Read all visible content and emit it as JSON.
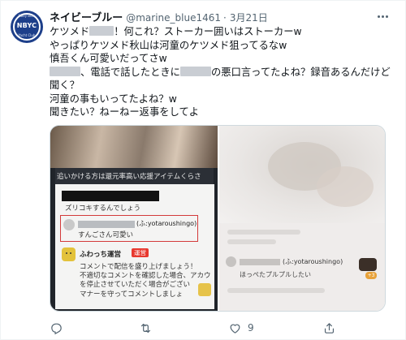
{
  "tweet": {
    "display_name": "ネイビーブルー",
    "handle": "@marine_blue1461",
    "separator": "·",
    "date": "3月21日",
    "avatar_text": "NBYC",
    "avatar_ring_top": "Navy Blue",
    "avatar_ring_bottom": "Yacht Club",
    "lines": [
      {
        "pre": "ケツメド",
        "post": "！何これ？ストーカー囲いはストーカーw"
      },
      {
        "text": "やっぱりケツメド秋山は河童のケツメド狙ってるなw"
      },
      {
        "text": "慎吾くん可愛いだってさw"
      },
      {
        "pre": "",
        "post": "、電話で話したときに",
        "post2": "の悪口言ってたよね？録音あるんだけど"
      },
      {
        "text": "聞く？"
      },
      {
        "text": "河童の事もいってたよね？w"
      },
      {
        "text": "聞きたい？ねーねー返事をしてよ"
      }
    ]
  },
  "media": {
    "photo1": {
      "top_bar_text": "追いかける方は還元率高い応援アイテムくらさ",
      "msg1": "ズリコキするんでしょう",
      "highlight_username": "(ふ:yotaroushingo)",
      "highlight_message": "すんごさん可愛い",
      "staff_name": "ふわっち運営",
      "staff_badge": "運営",
      "staff_lines": [
        "コメントで配信を盛り上げましょう！",
        "不適切なコメントを確認した場合、アカウ",
        "を停止させていただく場合がござい",
        "マナーを守ってコメントしましょ"
      ]
    },
    "photo2": {
      "username": "(ふ:yotaroushingo)",
      "message": "ほっぺたプルプルしたい",
      "badge": "+3"
    }
  },
  "actions": {
    "reply_count": "",
    "retweet_count": "",
    "like_count": "9",
    "share_count": ""
  }
}
